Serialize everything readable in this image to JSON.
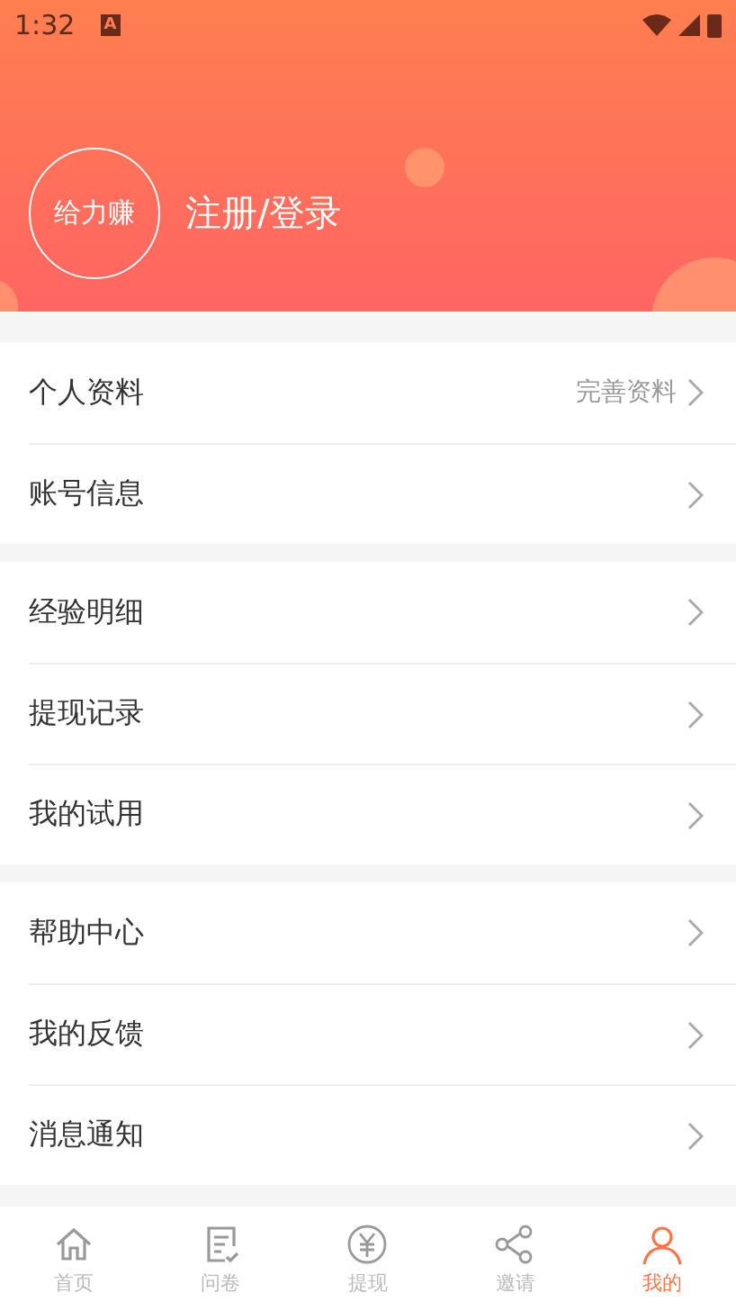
{
  "status_bar": {
    "time": "1:32",
    "notification_glyph": "A"
  },
  "profile": {
    "logo": "给力赚",
    "login": "注册/登录"
  },
  "groups": [
    {
      "items": [
        {
          "label": "个人资料",
          "hint": "完善资料"
        },
        {
          "label": "账号信息"
        }
      ]
    },
    {
      "items": [
        {
          "label": "经验明细"
        },
        {
          "label": "提现记录"
        },
        {
          "label": "我的试用"
        }
      ]
    },
    {
      "items": [
        {
          "label": "帮助中心"
        },
        {
          "label": "我的反馈"
        },
        {
          "label": "消息通知"
        }
      ]
    }
  ],
  "tabs": [
    {
      "kind": "home",
      "label": "首页",
      "selected": false
    },
    {
      "kind": "survey",
      "label": "问卷",
      "selected": false
    },
    {
      "kind": "withdraw",
      "label": "提现",
      "selected": false
    },
    {
      "kind": "invite",
      "label": "邀请",
      "selected": false
    },
    {
      "kind": "me",
      "label": "我的",
      "selected": true
    }
  ]
}
